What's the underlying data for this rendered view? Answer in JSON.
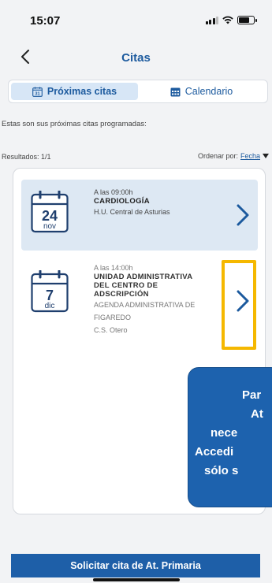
{
  "status_bar": {
    "time": "15:07"
  },
  "nav": {
    "title": "Citas"
  },
  "tabs": [
    {
      "label": "Próximas citas",
      "icon": "calendar-31-icon",
      "active": true
    },
    {
      "label": "Calendario",
      "icon": "calendar-grid-icon",
      "active": false
    }
  ],
  "intro": "Estas son sus próximas citas programadas:",
  "results": {
    "label": "Resultados: 1/1"
  },
  "sort": {
    "label": "Ordenar por:",
    "value": "Fecha"
  },
  "appointments": [
    {
      "day": "24",
      "month": "nov",
      "time": "A las 09:00h",
      "specialty": "CARDIOLOGÍA",
      "center_lines": [
        "H.U. Central de Asturias"
      ]
    },
    {
      "day": "7",
      "month": "dic",
      "time": "A las 14:00h",
      "specialty_lines": [
        "UNIDAD ADMINISTRATIVA",
        "DEL CENTRO DE",
        "ADSCRIPCIÓN"
      ],
      "center_lines": [
        "AGENDA ADMINISTRATIVA DE",
        "FIGAREDO",
        "C.S. Otero"
      ]
    }
  ],
  "tooltip": {
    "lines": [
      "Par",
      "At",
      "nece",
      "Accedi",
      "sólo s"
    ]
  },
  "bottom_button": {
    "label": "Solicitar cita de At. Primaria"
  },
  "colors": {
    "primary": "#1c5a9e",
    "tab_active_bg": "#d7e6f6",
    "card_highlight_bg": "#dde8f3",
    "highlight_border": "#f5b800",
    "tooltip_bg": "#1d62ae",
    "button_bg": "#1e5fa8"
  }
}
